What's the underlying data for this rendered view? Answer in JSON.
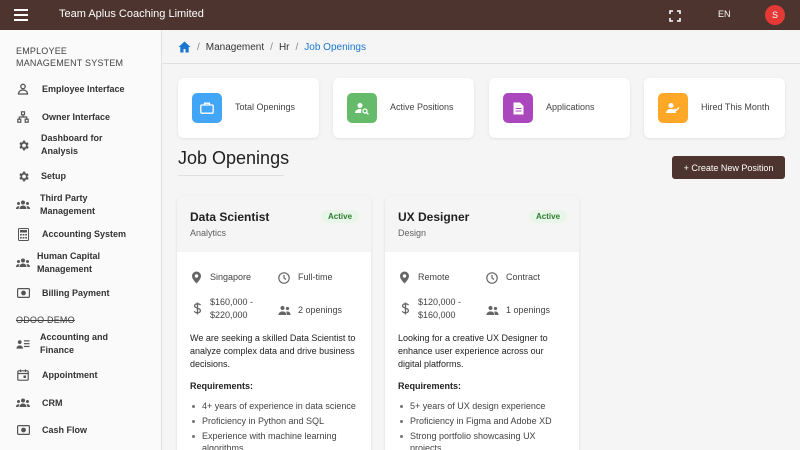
{
  "app": {
    "title": "Team Aplus Coaching Limited",
    "language": "EN",
    "avatar_initial": "S"
  },
  "sidebar": {
    "sections": [
      {
        "title": "EMPLOYEE MANAGEMENT SYSTEM"
      },
      {
        "title": "ODOO DEMO"
      }
    ],
    "items": [
      {
        "label": "Employee Interface",
        "icon": "person-icon"
      },
      {
        "label": "Owner Interface",
        "icon": "org-chart-icon"
      },
      {
        "label": "Dashboard for Analysis",
        "icon": "gear-icon"
      },
      {
        "label": "Setup",
        "icon": "gear-icon"
      },
      {
        "label": "Third Party Management",
        "icon": "group-icon"
      },
      {
        "label": "Accounting System",
        "icon": "calculator-icon"
      },
      {
        "label": "Human Capital Management",
        "icon": "group-icon"
      },
      {
        "label": "Billing Payment",
        "icon": "payment-icon"
      },
      {
        "label": "Accounting and Finance",
        "icon": "contact-card-icon"
      },
      {
        "label": "Appointment",
        "icon": "calendar-icon"
      },
      {
        "label": "CRM",
        "icon": "group-icon"
      },
      {
        "label": "Cash Flow",
        "icon": "payment-icon"
      }
    ]
  },
  "breadcrumb": {
    "items": [
      "Management",
      "Hr",
      "Job Openings"
    ]
  },
  "stats": [
    {
      "label": "Total Openings",
      "icon": "briefcase-icon",
      "color": "#42a5f5"
    },
    {
      "label": "Active Positions",
      "icon": "person-search-icon",
      "color": "#66bb6a"
    },
    {
      "label": "Applications",
      "icon": "document-icon",
      "color": "#ab47bc"
    },
    {
      "label": "Hired This Month",
      "icon": "person-check-icon",
      "color": "#ffa726"
    }
  ],
  "page": {
    "title": "Job Openings",
    "create_button": "+ Create New Position"
  },
  "jobs": [
    {
      "title": "Data Scientist",
      "department": "Analytics",
      "status": "Active",
      "location": "Singapore",
      "type": "Full-time",
      "salary_line1": "$160,000 -",
      "salary_line2": "$220,000",
      "openings": "2 openings",
      "description": "We are seeking a skilled Data Scientist to analyze complex data and drive business decisions.",
      "requirements_title": "Requirements:",
      "requirements": [
        "4+ years of experience in data science",
        "Proficiency in Python and SQL",
        "Experience with machine learning algorithms"
      ]
    },
    {
      "title": "UX Designer",
      "department": "Design",
      "status": "Active",
      "location": "Remote",
      "type": "Contract",
      "salary_line1": "$120,000 -",
      "salary_line2": "$160,000",
      "openings": "1 openings",
      "description": "Looking for a creative UX Designer to enhance user experience across our digital platforms.",
      "requirements_title": "Requirements:",
      "requirements": [
        "5+ years of UX design experience",
        "Proficiency in Figma and Adobe XD",
        "Strong portfolio showcasing UX projects"
      ]
    }
  ],
  "colors": {
    "topbar": "#4e342e",
    "accent": "#1976d2",
    "active_badge": "#2e7d32"
  }
}
